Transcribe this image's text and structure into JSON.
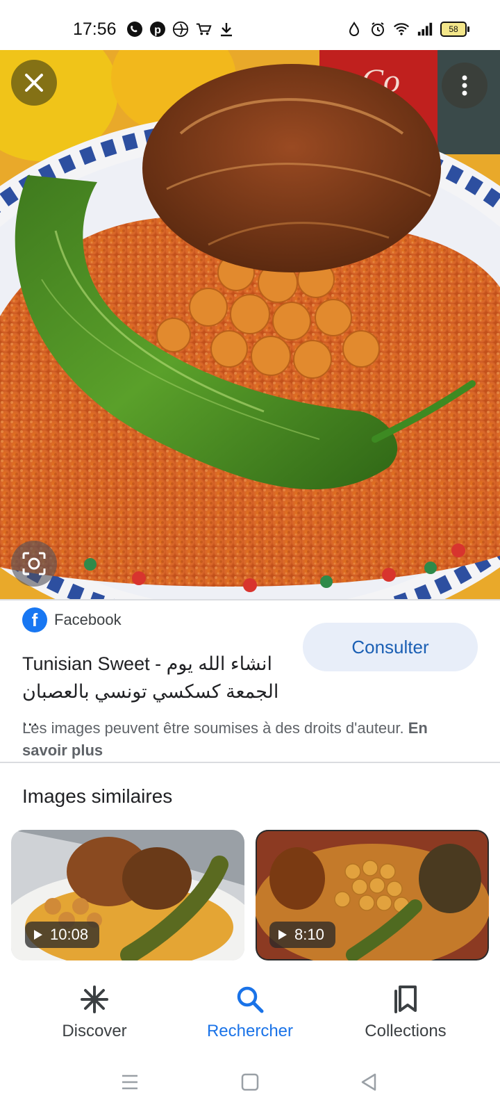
{
  "status_bar": {
    "time": "17:56",
    "left_icons": [
      "whatsapp-icon",
      "pinterest-icon",
      "app-icon",
      "cart-icon",
      "download-icon"
    ],
    "right_icons": [
      "data-saver-icon",
      "alarm-icon",
      "wifi-icon",
      "signal-icon"
    ],
    "battery": "58"
  },
  "viewer": {
    "close_icon": "close-icon",
    "more_icon": "more-vert-icon",
    "lens_icon": "lens-icon"
  },
  "result": {
    "source": "Facebook",
    "title": "Tunisian Sweet - انشاء الله يوم الجمعة كسكسي تونسي بالعصبان ...",
    "action_label": "Consulter",
    "rights_text": "Les images peuvent être soumises à des droits d'auteur.",
    "learn_more": "En savoir plus"
  },
  "similar": {
    "heading": "Images similaires",
    "items": [
      {
        "duration": "10:08"
      },
      {
        "duration": "8:10"
      }
    ]
  },
  "bottom_nav": {
    "items": [
      {
        "label": "Discover",
        "icon": "asterisk-icon"
      },
      {
        "label": "Rechercher",
        "icon": "search-icon"
      },
      {
        "label": "Collections",
        "icon": "collections-icon"
      }
    ],
    "active": "Rechercher",
    "accent": "#1a73e8"
  },
  "system_nav": [
    "menu-icon",
    "home-icon",
    "back-icon"
  ]
}
